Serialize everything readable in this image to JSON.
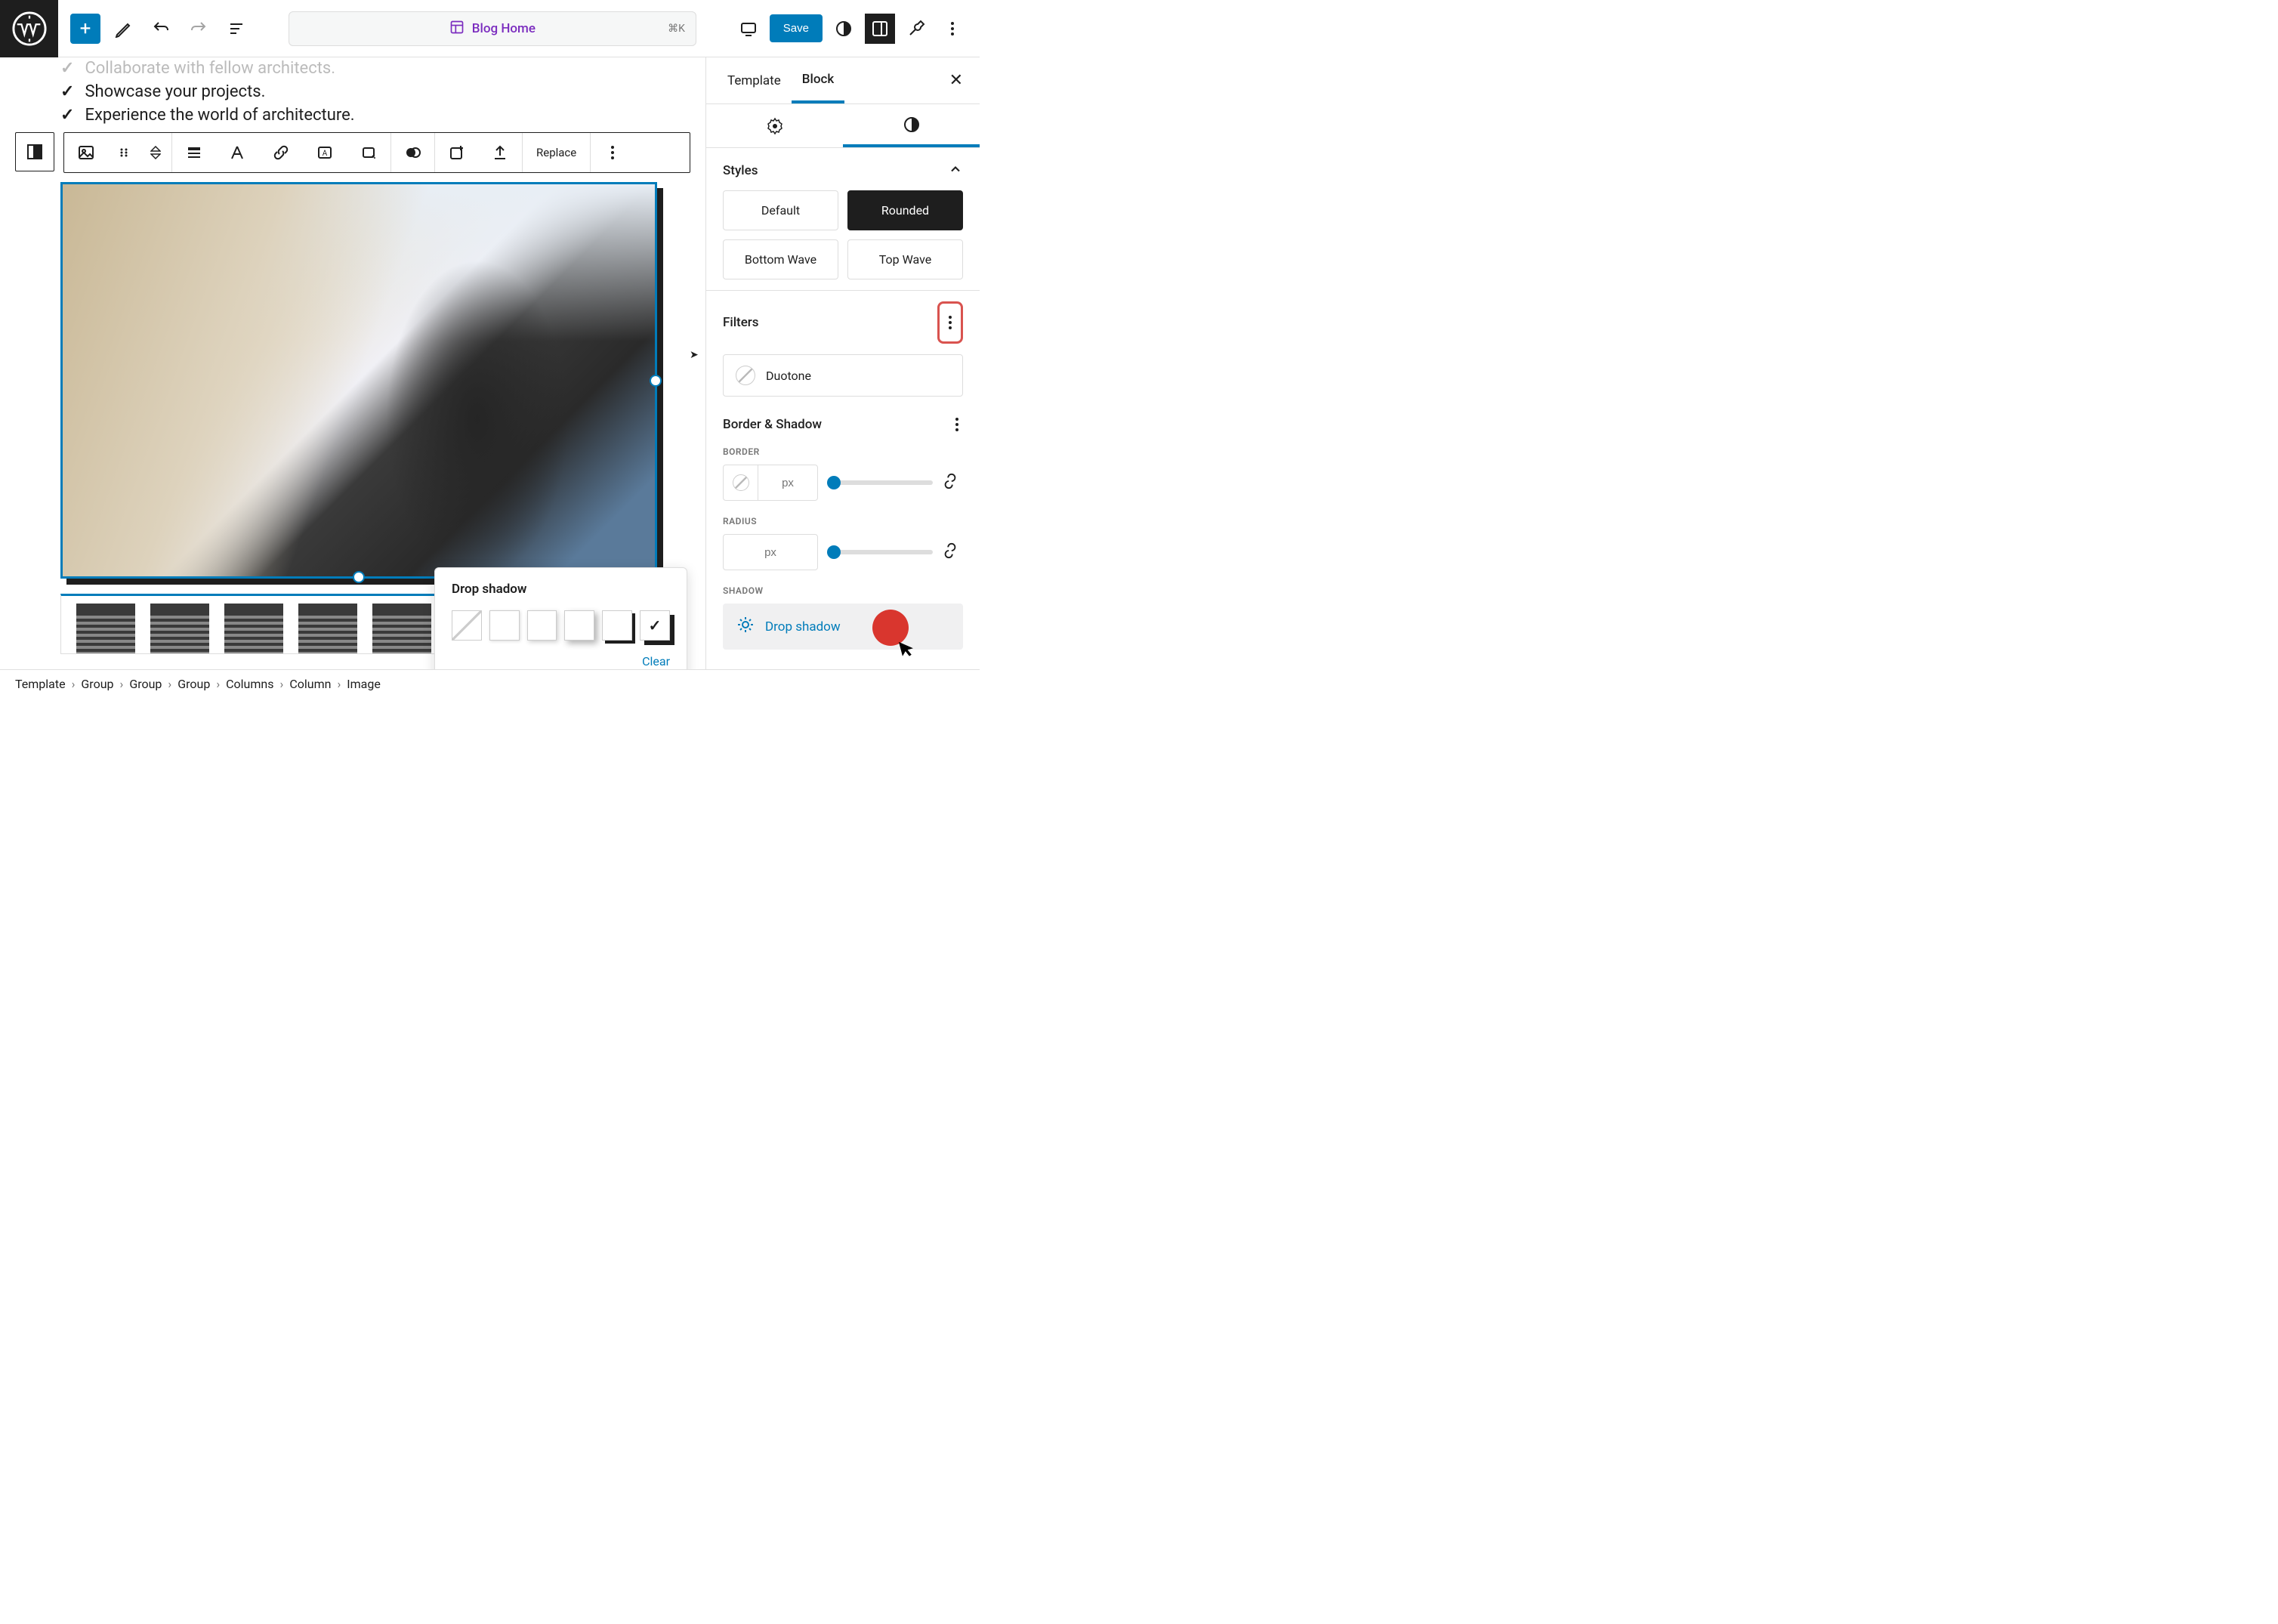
{
  "topbar": {
    "doc_title": "Blog Home",
    "shortcut": "⌘K",
    "save_label": "Save"
  },
  "content": {
    "items": [
      "Collaborate with fellow architects.",
      "Showcase your projects.",
      "Experience the world of architecture."
    ]
  },
  "block_toolbar": {
    "replace_label": "Replace"
  },
  "shadow_popover": {
    "title": "Drop shadow",
    "clear_label": "Clear"
  },
  "sidebar": {
    "tabs": {
      "template": "Template",
      "block": "Block"
    },
    "styles": {
      "title": "Styles",
      "options": [
        "Default",
        "Rounded",
        "Bottom Wave",
        "Top Wave"
      ],
      "active_index": 1
    },
    "filters": {
      "title": "Filters",
      "duotone_label": "Duotone"
    },
    "border_shadow": {
      "title": "Border & Shadow",
      "border_label": "BORDER",
      "radius_label": "RADIUS",
      "shadow_label": "SHADOW",
      "unit": "px",
      "drop_shadow_label": "Drop shadow"
    }
  },
  "breadcrumb": [
    "Template",
    "Group",
    "Group",
    "Group",
    "Columns",
    "Column",
    "Image"
  ]
}
